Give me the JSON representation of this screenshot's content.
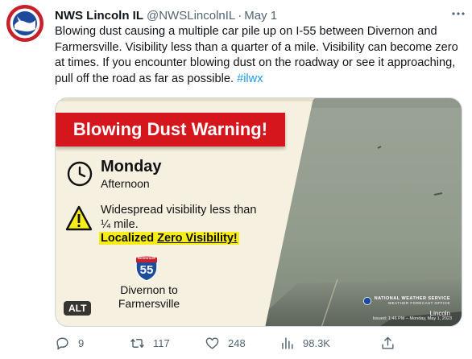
{
  "tweet": {
    "author_name": "NWS Lincoln IL",
    "author_handle": "@NWSLincolnIL",
    "separator": "·",
    "date": "May 1",
    "text": "Blowing dust causing a multiple car pile up on I-55 between Divernon and Farmersville. Visibility less than a quarter of a mile. Visibility can become zero at times.  If you encounter blowing dust on the roadway or see it approaching, pull off the road as far as possible.",
    "hashtag": "#ilwx",
    "avatar_text": "NATIONAL WEATHER SERVICE",
    "more_icon": "more-dots-icon"
  },
  "graphic": {
    "banner": "Blowing Dust Warning!",
    "day": "Monday",
    "daypart": "Afternoon",
    "visibility_line": "Widespread visibility less than ¼ mile.",
    "zero_prefix": "Localized ",
    "zero_text": "Zero Visibility!",
    "shield_label": "INTERSTATE",
    "shield_number": "55",
    "route": "Divernon to Farmersville",
    "nws_line1": "NATIONAL WEATHER SERVICE",
    "nws_line2": "WEATHER FORECAST OFFICE",
    "nws_office": "Lincoln",
    "issued": "Issued: 1:46 PM – Monday, May 1, 2023",
    "alt": "ALT"
  },
  "actions": {
    "replies": "9",
    "retweets": "117",
    "likes": "248",
    "views": "98.3K"
  },
  "colors": {
    "banner_red": "#d6161d",
    "highlight_yellow": "#f6ec18",
    "link_blue": "#1d9bf0",
    "muted": "#536471",
    "panel_cream": "#f6f0e0",
    "dust_gray": "#8f9a8a"
  }
}
